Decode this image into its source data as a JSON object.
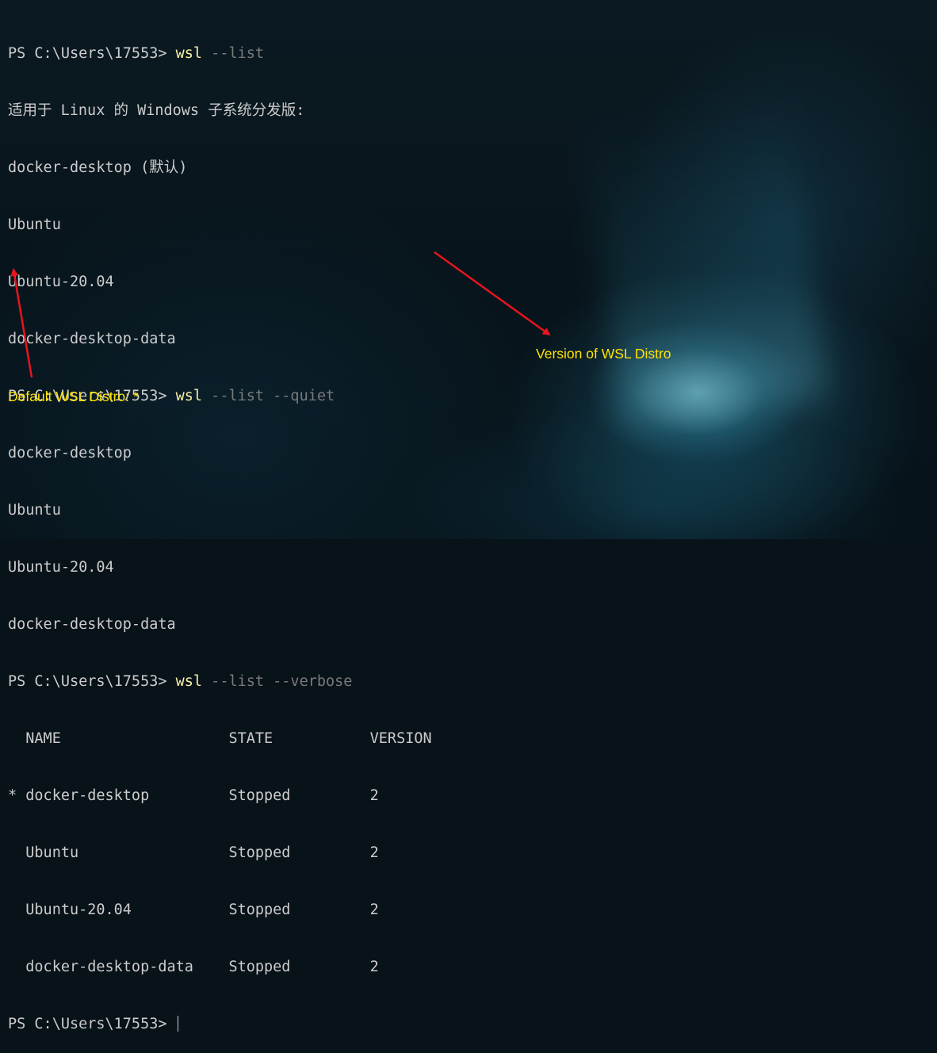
{
  "terminal": {
    "prompt": "PS C:\\Users\\17553> ",
    "commands": [
      {
        "cmd": "wsl",
        "args": " --list"
      },
      {
        "cmd": "wsl",
        "args": " --list --quiet"
      },
      {
        "cmd": "wsl",
        "args": " --list --verbose"
      }
    ],
    "list_output": [
      "适用于 Linux 的 Windows 子系统分发版:",
      "docker-desktop (默认)",
      "Ubuntu",
      "Ubuntu-20.04",
      "docker-desktop-data"
    ],
    "quiet_output": [
      "docker-desktop",
      "Ubuntu",
      "Ubuntu-20.04",
      "docker-desktop-data"
    ],
    "verbose_header": "  NAME                   STATE           VERSION",
    "verbose_rows": [
      "* docker-desktop         Stopped         2",
      "  Ubuntu                 Stopped         2",
      "  Ubuntu-20.04           Stopped         2",
      "  docker-desktop-data    Stopped         2"
    ]
  },
  "annotations": {
    "version_label": "Version of WSL Distro",
    "default_label": "Default WSL Distro: *",
    "color": "#ffe300",
    "arrow_color": "#e8141e"
  },
  "colors": {
    "command": "#f9f1a5",
    "argument": "#7a7a7a",
    "text": "#cccccc"
  }
}
